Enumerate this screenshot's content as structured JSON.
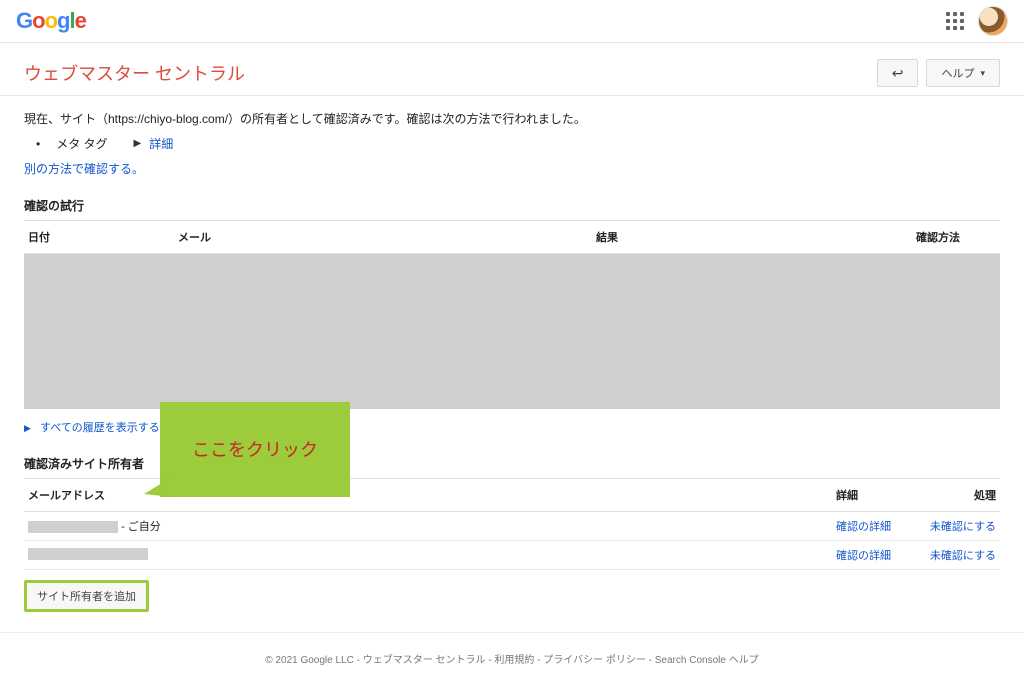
{
  "header": {
    "logo_letters": [
      "G",
      "o",
      "o",
      "g",
      "l",
      "e"
    ]
  },
  "page": {
    "title": "ウェブマスター セントラル",
    "back_arrow": "↩",
    "help_label": "ヘルプ"
  },
  "intro": {
    "line": "現在、サイト（https://chiyo-blog.com/）の所有者として確認済みです。確認は次の方法で行われました。",
    "bullet_label": "メタ タグ",
    "bullet_link": "詳細",
    "alt_method_link": "別の方法で確認する。"
  },
  "attempts": {
    "title": "確認の試行",
    "cols": {
      "date": "日付",
      "mail": "メール",
      "result": "結果",
      "method": "確認方法"
    },
    "show_all": "すべての履歴を表示する"
  },
  "owners": {
    "title": "確認済みサイト所有者",
    "cols": {
      "mail": "メールアドレス",
      "detail": "詳細",
      "action": "処理"
    },
    "rows": [
      {
        "suffix": " - ご自分",
        "detail": "確認の詳細",
        "action": "未確認にする"
      },
      {
        "suffix": "",
        "detail": "確認の詳細",
        "action": "未確認にする"
      }
    ],
    "add_button": "サイト所有者を追加"
  },
  "callout": {
    "text": "ここをクリック"
  },
  "footer": {
    "copyright": "© 2021 Google LLC - ",
    "links": [
      "ウェブマスター セントラル",
      "利用規約",
      "プライバシー ポリシー",
      "Search Console ヘルプ"
    ]
  }
}
